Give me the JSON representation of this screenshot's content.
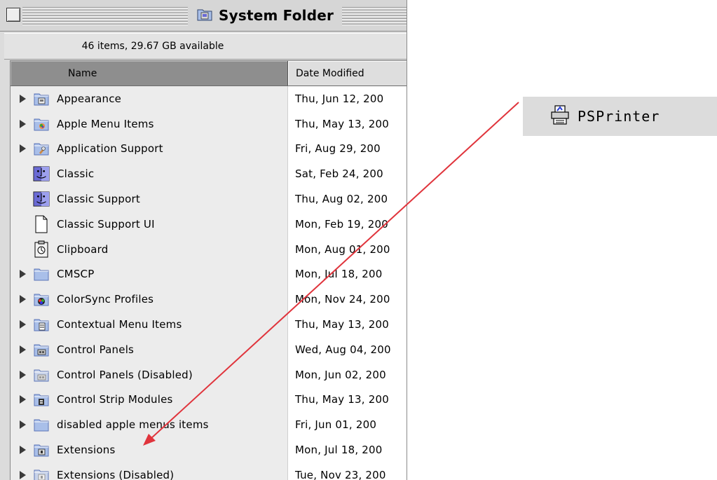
{
  "window": {
    "title": "System Folder",
    "info": "46 items, 29.67 GB available",
    "columns": {
      "name": "Name",
      "date": "Date Modified"
    }
  },
  "items": [
    {
      "name": "Appearance",
      "date": "Thu, Jun 12, 200",
      "type": "folder",
      "expandable": true,
      "icon": "appearance-folder-icon"
    },
    {
      "name": "Apple Menu Items",
      "date": "Thu, May 13, 200",
      "type": "folder",
      "expandable": true,
      "icon": "apple-menu-folder-icon"
    },
    {
      "name": "Application Support",
      "date": "Fri, Aug 29, 200",
      "type": "folder",
      "expandable": true,
      "icon": "app-support-folder-icon"
    },
    {
      "name": "Classic",
      "date": "Sat, Feb 24, 200",
      "type": "app",
      "expandable": false,
      "icon": "mac-os-face-icon"
    },
    {
      "name": "Classic Support",
      "date": "Thu, Aug 02, 200",
      "type": "app",
      "expandable": false,
      "icon": "mac-os-face-icon"
    },
    {
      "name": "Classic Support UI",
      "date": "Mon, Feb 19, 200",
      "type": "document",
      "expandable": false,
      "icon": "blank-document-icon"
    },
    {
      "name": "Clipboard",
      "date": "Mon, Aug 01, 200",
      "type": "clipboard",
      "expandable": false,
      "icon": "clipboard-icon"
    },
    {
      "name": "CMSCP",
      "date": "Mon, Jul 18, 200",
      "type": "folder",
      "expandable": true,
      "icon": "folder-icon"
    },
    {
      "name": "ColorSync Profiles",
      "date": "Mon, Nov 24, 200",
      "type": "folder",
      "expandable": true,
      "icon": "colorsync-folder-icon"
    },
    {
      "name": "Contextual Menu Items",
      "date": "Thu, May 13, 200",
      "type": "folder",
      "expandable": true,
      "icon": "contextual-menu-folder-icon"
    },
    {
      "name": "Control Panels",
      "date": "Wed, Aug 04, 200",
      "type": "folder",
      "expandable": true,
      "icon": "control-panels-folder-icon"
    },
    {
      "name": "Control Panels (Disabled)",
      "date": "Mon, Jun 02, 200",
      "type": "folder",
      "expandable": true,
      "icon": "control-panels-disabled-folder-icon"
    },
    {
      "name": "Control Strip Modules",
      "date": "Thu, May 13, 200",
      "type": "folder",
      "expandable": true,
      "icon": "control-strip-folder-icon"
    },
    {
      "name": "disabled apple menus items",
      "date": "Fri, Jun 01, 200",
      "type": "folder",
      "expandable": true,
      "icon": "folder-icon"
    },
    {
      "name": "Extensions",
      "date": "Mon, Jul 18, 200",
      "type": "folder",
      "expandable": true,
      "icon": "extensions-folder-icon"
    },
    {
      "name": "Extensions (Disabled)",
      "date": "Tue, Nov 23, 200",
      "type": "folder",
      "expandable": true,
      "icon": "extensions-disabled-folder-icon"
    }
  ],
  "dragged_item": {
    "name": "PSPrinter",
    "icon": "printer-icon"
  },
  "annotation": {
    "arrow_color": "#e0343c",
    "from": "PSPrinter",
    "to": "Extensions"
  },
  "colors": {
    "folder": "#a9bfe9",
    "folder_dark": "#5b74b6",
    "mac_face": "#6a6ad4"
  }
}
